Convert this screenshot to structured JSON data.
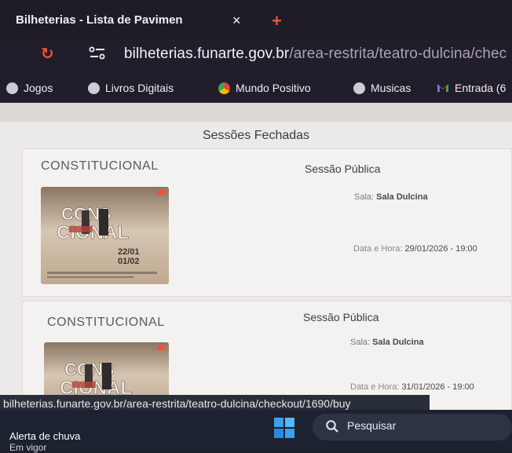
{
  "browser": {
    "tab_title": "Bilheterias - Lista de Pavimen",
    "tab_close": "×",
    "new_tab": "+",
    "url_domain": "bilheterias.funarte.gov.br",
    "url_path": "/area-restrita/teatro-dulcina/chec",
    "bookmarks": [
      {
        "label": "Jogos",
        "icon": "globe-icon"
      },
      {
        "label": "Livros Digitais",
        "icon": "globe-icon"
      },
      {
        "label": "Mundo Positivo",
        "icon": "chrome-icon"
      },
      {
        "label": "Musicas",
        "icon": "globe-icon"
      },
      {
        "label": "Entrada (6",
        "icon": "gmail-icon"
      }
    ]
  },
  "page": {
    "section_title": "Sessões Fechadas",
    "sessions": [
      {
        "play": "CONSTITUCIONAL",
        "type": "Sessão Pública",
        "room_label": "Sala:",
        "room_value": "Sala Dulcina",
        "datetime_label": "Data e Hora:",
        "datetime_value": "29/01/2026 - 19:00",
        "poster_dates": [
          "22/01",
          "01/02"
        ]
      },
      {
        "play": "CONSTITUCIONAL",
        "type": "Sessão Pública",
        "room_label": "Sala:",
        "room_value": "Sala Dulcina",
        "datetime_label": "Data e Hora:",
        "datetime_value": "31/01/2026 - 19:00"
      }
    ]
  },
  "status_url": "bilheterias.funarte.gov.br/area-restrita/teatro-dulcina/checkout/1690/buy",
  "taskbar": {
    "weather_title": "Alerta de chuva",
    "weather_sub": "Em vigor",
    "search_label": "Pesquisar"
  },
  "colors": {
    "accent": "#e8553d",
    "chrome_bg": "#221d2b",
    "page_bg": "#eceae9"
  }
}
